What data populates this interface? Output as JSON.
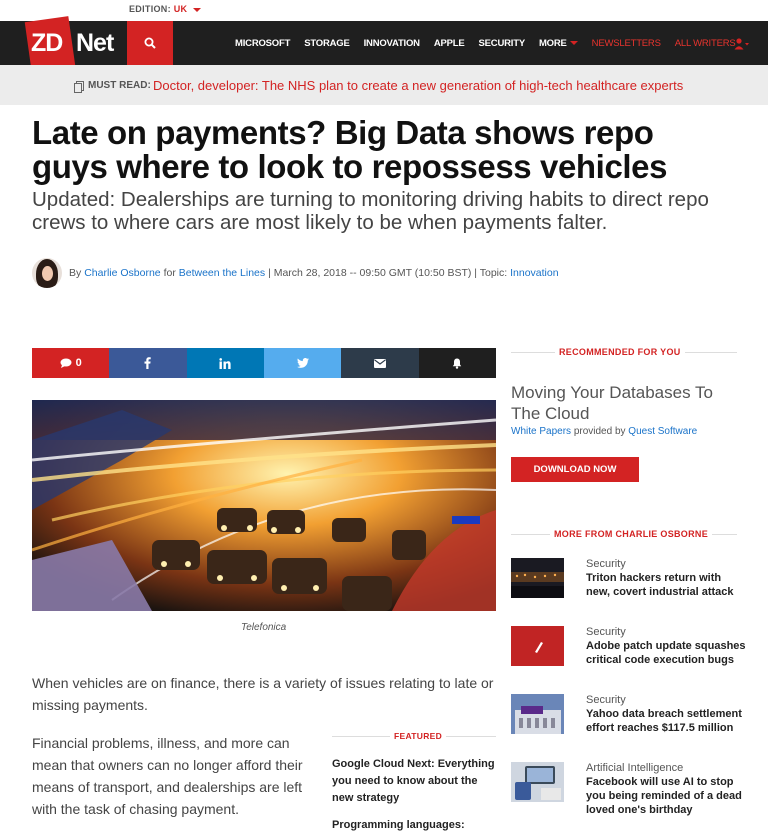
{
  "edition": {
    "label": "EDITION:",
    "value": "UK"
  },
  "logo": {
    "zd": "ZD",
    "net": "Net"
  },
  "nav": {
    "items": [
      "MICROSOFT",
      "STORAGE",
      "INNOVATION",
      "APPLE",
      "SECURITY"
    ],
    "more": "MORE",
    "newsletters": "NEWSLETTERS",
    "all_writers": "ALL WRITERS"
  },
  "must_read": {
    "label": "MUST READ:",
    "link": "Doctor, developer: The NHS plan to create a new generation of high-tech healthcare experts"
  },
  "article": {
    "title": "Late on payments? Big Data shows repo guys where to look to repossess vehicles",
    "subtitle": "Updated: Dealerships are turning to monitoring driving habits to direct repo crews to where cars are most likely to be when payments falter.",
    "by": "By",
    "author": "Charlie Osborne",
    "for": "for",
    "blog": "Between the Lines",
    "date": "| March 28, 2018 -- 09:50 GMT (10:50 BST) | Topic:",
    "topic": "Innovation",
    "caption": "Telefonica",
    "p1": "When vehicles are on finance, there is a variety of issues relating to late or missing payments.",
    "p2": "Financial problems, illness, and more can mean that owners can no longer afford their means of transport, and dealerships are left with the task of chasing payment."
  },
  "share": {
    "comments": "0"
  },
  "featured": {
    "label": "FEATURED",
    "items": [
      "Google Cloud Next: Everything you need to know about the new strategy",
      "Programming languages:"
    ]
  },
  "recommended": {
    "label": "RECOMMENDED FOR YOU",
    "title": "Moving Your Databases To The Cloud",
    "type": "White Papers",
    "provided_by": "provided by",
    "vendor": "Quest Software",
    "button": "DOWNLOAD NOW"
  },
  "more_from": {
    "label": "MORE FROM CHARLIE OSBORNE",
    "stories": [
      {
        "category": "Security",
        "title": "Triton hackers return with new, covert industrial attack"
      },
      {
        "category": "Security",
        "title": "Adobe patch update squashes critical code execution bugs"
      },
      {
        "category": "Security",
        "title": "Yahoo data breach settlement effort reaches $117.5 million"
      },
      {
        "category": "Artificial Intelligence",
        "title": "Facebook will use AI to stop you being reminded of a dead loved one's birthday"
      }
    ]
  },
  "colors": {
    "brand": "#d32323",
    "link": "#1a73c9",
    "nav_bg": "#1f1f1f"
  }
}
